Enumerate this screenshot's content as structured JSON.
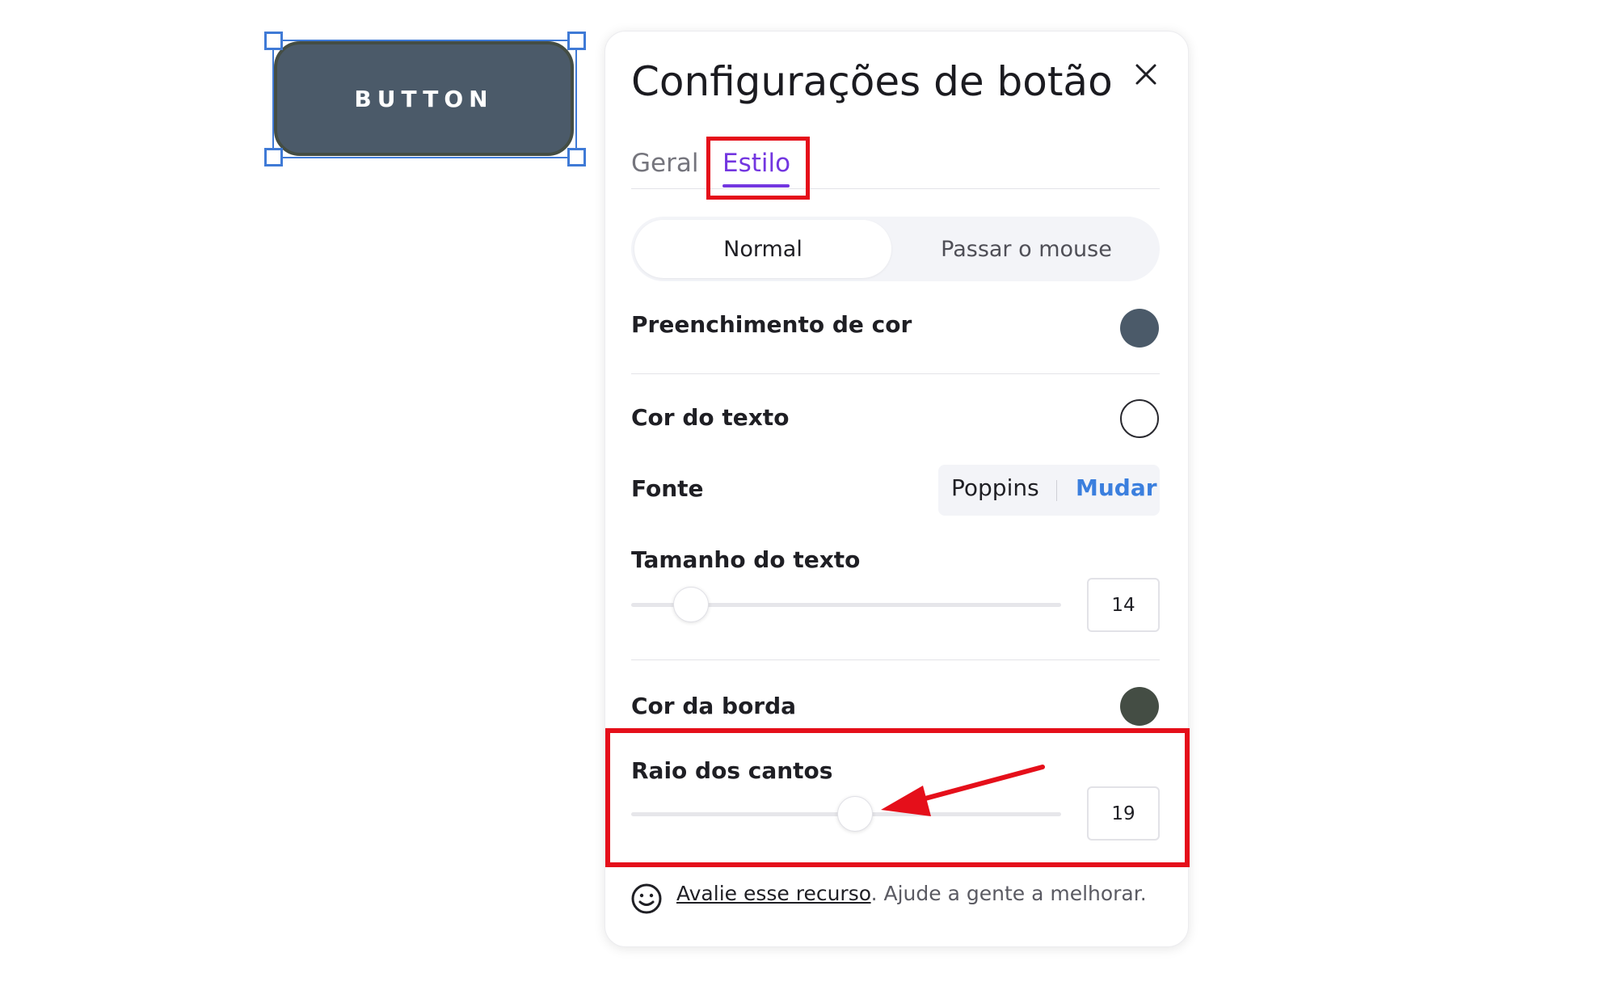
{
  "canvas": {
    "button_label": "BUTTON"
  },
  "panel": {
    "title": "Configurações de botão",
    "close_icon": "close-icon",
    "tabs": [
      {
        "label": "Geral",
        "active": false
      },
      {
        "label": "Estilo",
        "active": true
      }
    ],
    "states": [
      {
        "label": "Normal",
        "active": true
      },
      {
        "label": "Passar o mouse",
        "active": false
      }
    ],
    "fill_color": {
      "label": "Preenchimento de cor",
      "color": "#4b5a69"
    },
    "text_color": {
      "label": "Cor do texto",
      "color": "#ffffff"
    },
    "font": {
      "label": "Fonte",
      "value": "Poppins",
      "change_label": "Mudar"
    },
    "text_size": {
      "label": "Tamanho do texto",
      "value": "14",
      "slider_fraction": 0.14
    },
    "border_color": {
      "label": "Cor da borda",
      "color": "#444d44"
    },
    "corner_radius": {
      "label": "Raio dos cantos",
      "value": "19",
      "slider_fraction": 0.52
    },
    "feedback": {
      "icon": "smile-icon",
      "link": "Avalie esse recurso",
      "text": ". Ajude a gente a melhorar."
    }
  },
  "colors": {
    "accent": "#7336e0",
    "link_blue": "#3b7fde",
    "annotation_red": "#e50f1a",
    "selection_blue": "#3f7ad6"
  }
}
